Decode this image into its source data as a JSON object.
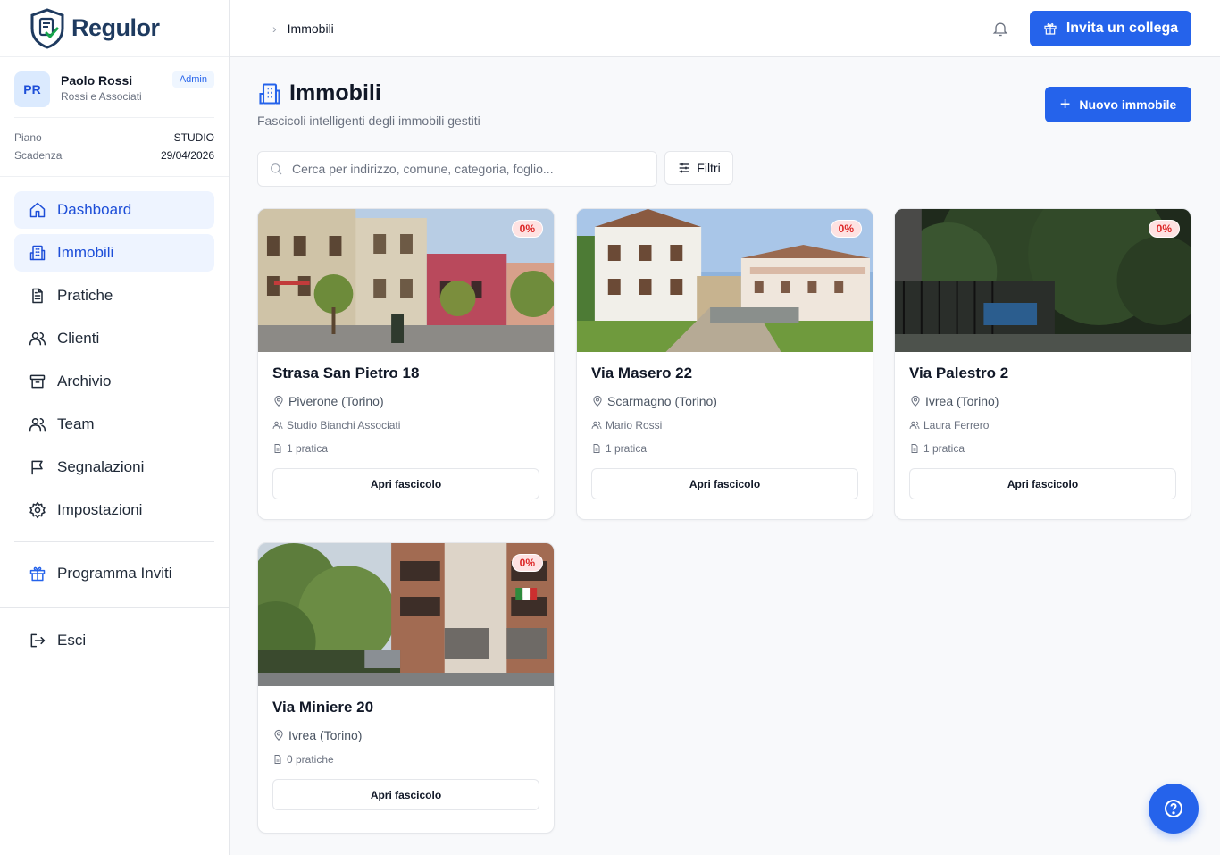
{
  "brand": {
    "name": "Regulor"
  },
  "user": {
    "initials": "PR",
    "name": "Paolo Rossi",
    "org": "Rossi e Associati",
    "role_badge": "Admin",
    "plan_label": "Piano",
    "plan_value": "STUDIO",
    "expiry_label": "Scadenza",
    "expiry_value": "29/04/2026"
  },
  "sidebar": {
    "items": [
      {
        "label": "Dashboard",
        "icon": "home-icon"
      },
      {
        "label": "Immobili",
        "icon": "building-icon",
        "active": true
      },
      {
        "label": "Pratiche",
        "icon": "document-icon"
      },
      {
        "label": "Clienti",
        "icon": "users-icon"
      },
      {
        "label": "Archivio",
        "icon": "archive-icon"
      },
      {
        "label": "Team",
        "icon": "team-icon"
      },
      {
        "label": "Segnalazioni",
        "icon": "flag-icon"
      },
      {
        "label": "Impostazioni",
        "icon": "gear-icon"
      }
    ],
    "invites": "Programma Inviti",
    "logout": "Esci"
  },
  "topbar": {
    "breadcrumb": "Immobili",
    "invite_button": "Invita un collega"
  },
  "page": {
    "title": "Immobili",
    "subtitle": "Fascicoli intelligenti degli immobili gestiti",
    "new_button": "Nuovo immobile",
    "search_placeholder": "Cerca per indirizzo, comune, categoria, foglio...",
    "filters_button": "Filtri"
  },
  "cards": [
    {
      "title": "Strasa San Pietro 18",
      "location": "Piverone (Torino)",
      "client": "Studio Bianchi Associati",
      "practices": "1 pratica",
      "progress": "0%",
      "button": "Apri fascicolo"
    },
    {
      "title": "Via Masero 22",
      "location": "Scarmagno (Torino)",
      "client": "Mario Rossi",
      "practices": "1 pratica",
      "progress": "0%",
      "button": "Apri fascicolo"
    },
    {
      "title": "Via Palestro 2",
      "location": "Ivrea (Torino)",
      "client": "Laura Ferrero",
      "practices": "1 pratica",
      "progress": "0%",
      "button": "Apri fascicolo"
    },
    {
      "title": "Via Miniere 20",
      "location": "Ivrea (Torino)",
      "practices": "0 pratiche",
      "progress": "0%",
      "button": "Apri fascicolo"
    }
  ],
  "colors": {
    "accent": "#2563eb",
    "badge_bg": "#fee2e2",
    "badge_text": "#dc2626"
  }
}
